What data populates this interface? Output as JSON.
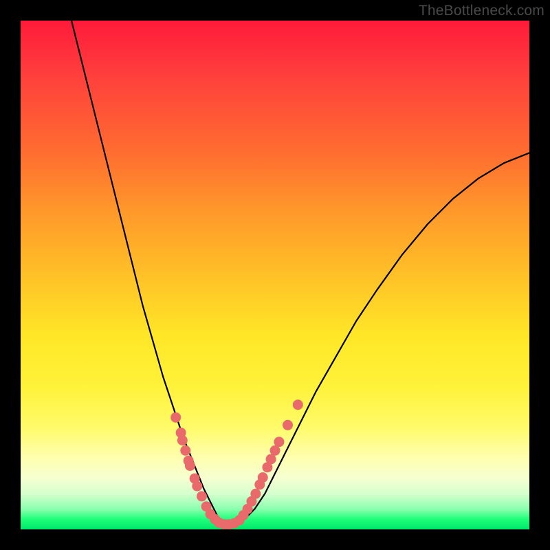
{
  "watermark": "TheBottleneck.com",
  "chart_data": {
    "type": "line",
    "title": "",
    "xlabel": "",
    "ylabel": "",
    "xlim": [
      0,
      100
    ],
    "ylim": [
      0,
      100
    ],
    "series": [
      {
        "name": "curve",
        "x": [
          10,
          12,
          14,
          16,
          18,
          20,
          22,
          24,
          26,
          28,
          30,
          32,
          34,
          36,
          37,
          38,
          39,
          40,
          41,
          42,
          44,
          46,
          48,
          50,
          52,
          55,
          58,
          62,
          66,
          70,
          75,
          80,
          85,
          90,
          95,
          100
        ],
        "y": [
          100,
          92,
          84,
          76,
          68,
          60,
          52,
          44,
          37,
          30,
          24,
          18,
          13,
          8,
          6,
          4,
          2,
          1,
          1,
          1,
          2,
          4,
          7,
          11,
          15,
          21,
          27,
          34,
          41,
          47,
          54,
          60,
          65,
          69,
          72,
          74
        ]
      }
    ],
    "markers": [
      {
        "x": 30.5,
        "y": 22
      },
      {
        "x": 31.5,
        "y": 19
      },
      {
        "x": 31.8,
        "y": 17.5
      },
      {
        "x": 32.4,
        "y": 15.5
      },
      {
        "x": 33.0,
        "y": 13.5
      },
      {
        "x": 33.3,
        "y": 12.5
      },
      {
        "x": 34.2,
        "y": 10
      },
      {
        "x": 34.7,
        "y": 8.5
      },
      {
        "x": 35.6,
        "y": 6.5
      },
      {
        "x": 36.5,
        "y": 4.5
      },
      {
        "x": 37.3,
        "y": 3
      },
      {
        "x": 38.2,
        "y": 2
      },
      {
        "x": 39.0,
        "y": 1.3
      },
      {
        "x": 40.0,
        "y": 1
      },
      {
        "x": 41.0,
        "y": 1
      },
      {
        "x": 42.0,
        "y": 1.2
      },
      {
        "x": 43.0,
        "y": 1.8
      },
      {
        "x": 43.8,
        "y": 2.8
      },
      {
        "x": 44.6,
        "y": 4
      },
      {
        "x": 45.4,
        "y": 5.5
      },
      {
        "x": 46.2,
        "y": 7
      },
      {
        "x": 47.0,
        "y": 8.8
      },
      {
        "x": 47.6,
        "y": 10.2
      },
      {
        "x": 48.5,
        "y": 12.2
      },
      {
        "x": 49.2,
        "y": 13.8
      },
      {
        "x": 50.0,
        "y": 15.5
      },
      {
        "x": 50.8,
        "y": 17.2
      },
      {
        "x": 52.5,
        "y": 20.5
      },
      {
        "x": 54.5,
        "y": 24.5
      }
    ],
    "marker_color": "#e86a6a",
    "curve_color": "#000000"
  }
}
